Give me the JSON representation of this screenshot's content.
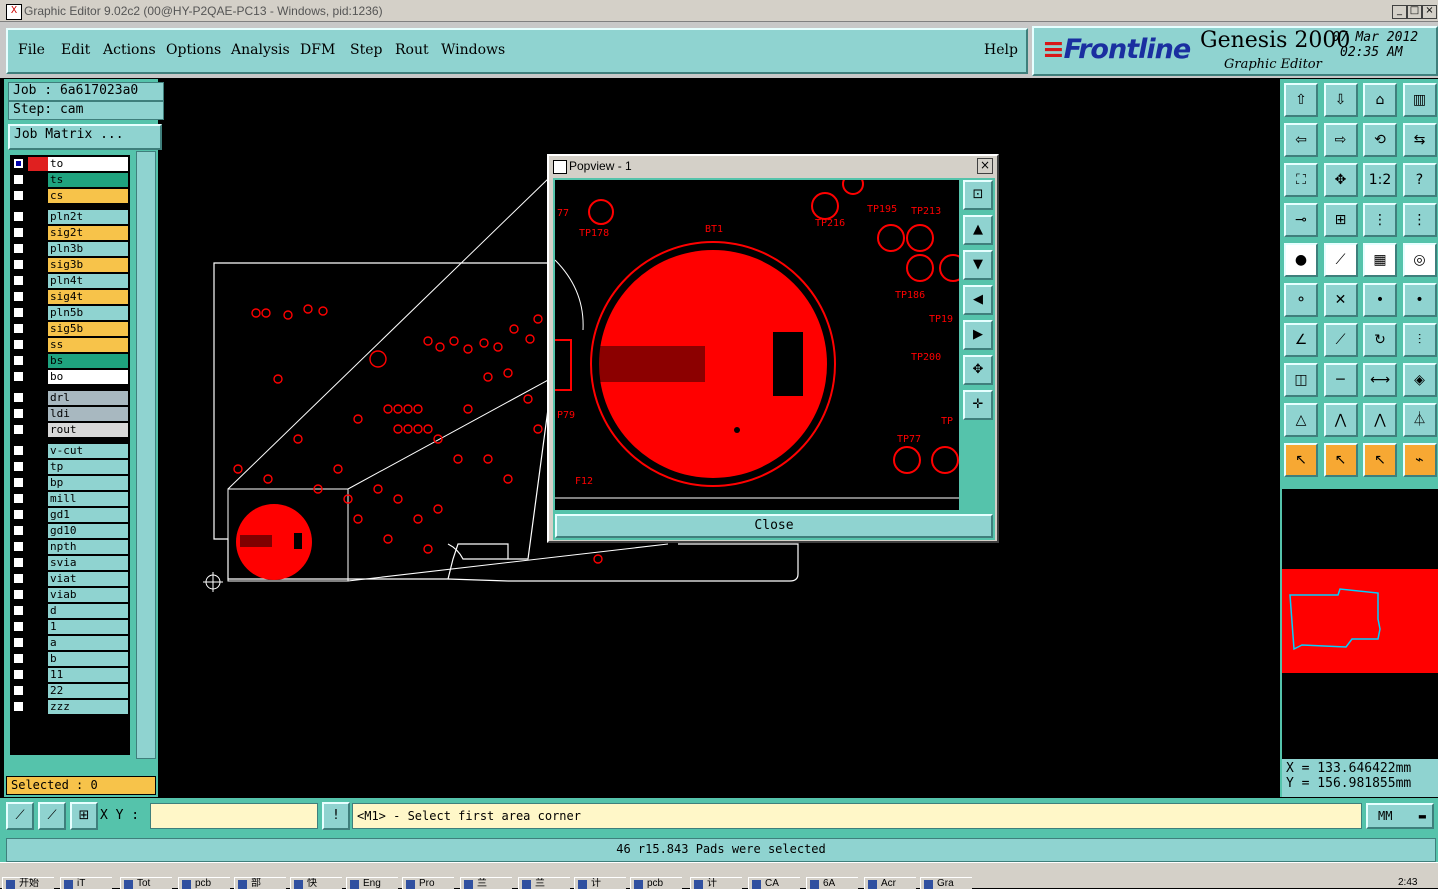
{
  "window": {
    "title": "Graphic Editor 9.02c2 (00@HY-P2QAE-PC13 - Windows, pid:1236)",
    "icon_label": "X",
    "controls": [
      "minimize-icon",
      "maximize-icon",
      "close-icon"
    ]
  },
  "menu": {
    "items": [
      "File",
      "Edit",
      "Actions",
      "Options",
      "Analysis",
      "DFM",
      "Step",
      "Rout",
      "Windows"
    ],
    "help": "Help"
  },
  "brand": {
    "logo": "Frontline",
    "product": "Genesis 2000",
    "subtitle": "Graphic Editor",
    "date": "07 Mar 2012",
    "time": "02:35 AM"
  },
  "left": {
    "job": "Job : 6a617023a0",
    "step": "Step: cam",
    "job_matrix": "Job Matrix ...",
    "selected": "Selected : 0",
    "layers": [
      {
        "name": "to",
        "bg": "#ffffff",
        "sw": "#e02020",
        "on": true
      },
      {
        "name": "ts",
        "bg": "#1fa37f",
        "sw": "#000000",
        "on": false
      },
      {
        "name": "cs",
        "bg": "#f7c34a",
        "sw": "#000000",
        "on": false
      },
      {
        "name": "pln2t",
        "bg": "#8fd3d0",
        "sw": "#000000",
        "on": false
      },
      {
        "name": "sig2t",
        "bg": "#f7c34a",
        "sw": "#000000",
        "on": false
      },
      {
        "name": "pln3b",
        "bg": "#8fd3d0",
        "sw": "#000000",
        "on": false
      },
      {
        "name": "sig3b",
        "bg": "#f7c34a",
        "sw": "#000000",
        "on": false
      },
      {
        "name": "pln4t",
        "bg": "#8fd3d0",
        "sw": "#000000",
        "on": false
      },
      {
        "name": "sig4t",
        "bg": "#f7c34a",
        "sw": "#000000",
        "on": false
      },
      {
        "name": "pln5b",
        "bg": "#8fd3d0",
        "sw": "#000000",
        "on": false
      },
      {
        "name": "sig5b",
        "bg": "#f7c34a",
        "sw": "#000000",
        "on": false
      },
      {
        "name": "ss",
        "bg": "#f7c34a",
        "sw": "#000000",
        "on": false
      },
      {
        "name": "bs",
        "bg": "#1fa37f",
        "sw": "#000000",
        "on": false
      },
      {
        "name": "bo",
        "bg": "#ffffff",
        "sw": "#000000",
        "on": false
      },
      {
        "name": "drl",
        "bg": "#a8b8c0",
        "sw": "#000000",
        "on": false
      },
      {
        "name": "ldi",
        "bg": "#a8b8c0",
        "sw": "#000000",
        "on": false
      },
      {
        "name": "rout",
        "bg": "#d8d8d8",
        "sw": "#000000",
        "on": false
      },
      {
        "name": "v-cut",
        "bg": "#8fd3d0",
        "sw": "#000000",
        "on": false
      },
      {
        "name": "tp",
        "bg": "#8fd3d0",
        "sw": "#000000",
        "on": false
      },
      {
        "name": "bp",
        "bg": "#8fd3d0",
        "sw": "#000000",
        "on": false
      },
      {
        "name": "mill",
        "bg": "#8fd3d0",
        "sw": "#000000",
        "on": false
      },
      {
        "name": "gd1",
        "bg": "#8fd3d0",
        "sw": "#000000",
        "on": false
      },
      {
        "name": "gd10",
        "bg": "#8fd3d0",
        "sw": "#000000",
        "on": false
      },
      {
        "name": "npth",
        "bg": "#8fd3d0",
        "sw": "#000000",
        "on": false
      },
      {
        "name": "svia",
        "bg": "#8fd3d0",
        "sw": "#000000",
        "on": false
      },
      {
        "name": "viat",
        "bg": "#8fd3d0",
        "sw": "#000000",
        "on": false
      },
      {
        "name": "viab",
        "bg": "#8fd3d0",
        "sw": "#000000",
        "on": false
      },
      {
        "name": "d",
        "bg": "#8fd3d0",
        "sw": "#000000",
        "on": false
      },
      {
        "name": "1",
        "bg": "#8fd3d0",
        "sw": "#000000",
        "on": false
      },
      {
        "name": "a",
        "bg": "#8fd3d0",
        "sw": "#000000",
        "on": false
      },
      {
        "name": "b",
        "bg": "#8fd3d0",
        "sw": "#000000",
        "on": false
      },
      {
        "name": "11",
        "bg": "#8fd3d0",
        "sw": "#000000",
        "on": false
      },
      {
        "name": "22",
        "bg": "#8fd3d0",
        "sw": "#000000",
        "on": false
      },
      {
        "name": "zzz",
        "bg": "#8fd3d0",
        "sw": "#000000",
        "on": false
      }
    ]
  },
  "popview": {
    "title": "Popview - 1",
    "close_label": "Close",
    "labels": [
      "77",
      "TP178",
      "BT1",
      "TP216",
      "TP195",
      "TP213",
      "TP186",
      "TP19",
      "TP200",
      "P79",
      "TP77",
      "TP",
      "F12"
    ],
    "tools": [
      "fit-icon",
      "zoom-in-icon",
      "zoom-out-icon",
      "pan-left-icon",
      "pan-right-icon",
      "fit-screen-icon",
      "pan-icon"
    ]
  },
  "right": {
    "tools": [
      "up-arrow-icon",
      "down-arrow-icon",
      "home-icon",
      "layout-icon",
      "left-arrow-icon",
      "right-arrow-icon",
      "undo-redo-icon",
      "swap-icon",
      "fit-icon",
      "zoom-icon",
      "ratio-icon",
      "help-icon",
      "measure-icon",
      "grid-icon",
      "layer-red-icon",
      "layer-alt-icon",
      "pad-icon",
      "dashed-line-icon",
      "ruler-icon",
      "circle-select-icon",
      "connect-icon",
      "cross-icon",
      "point-icon",
      "point-alt-icon",
      "line-icon",
      "line-select-icon",
      "arc-icon",
      "text-f-icon",
      "snap-icon",
      "horizontal-line-icon",
      "dimension-icon",
      "group-icon",
      "triangle-icon",
      "triangle-select-icon",
      "triangle-up-icon",
      "triangle-alt-icon",
      "pointer-icon",
      "pointer-select-icon",
      "pointer-alt-icon",
      "route-icon"
    ],
    "ratio_label": "1:2",
    "coords": {
      "x": "X = 133.646422mm",
      "y": "Y = 156.981855mm"
    }
  },
  "bottom": {
    "xy_label": "X Y :",
    "xy_value": "",
    "prompt": "<M1> - Select first area corner",
    "units": "MM",
    "status": "46 r15.843 Pads were selected"
  },
  "taskbar": {
    "items": [
      "开始",
      "iT",
      "Tot",
      "pcb",
      "部",
      "快",
      "Eng",
      "Pro",
      "兰",
      "兰",
      "计",
      "pcb",
      "计",
      "CA",
      "6A",
      "Acr",
      "Gra"
    ],
    "clock": "2:43"
  },
  "colors": {
    "teal": "#55c3ab",
    "panel": "#8fd3d0",
    "copper": "#ff0000",
    "outline": "#ffffff"
  }
}
